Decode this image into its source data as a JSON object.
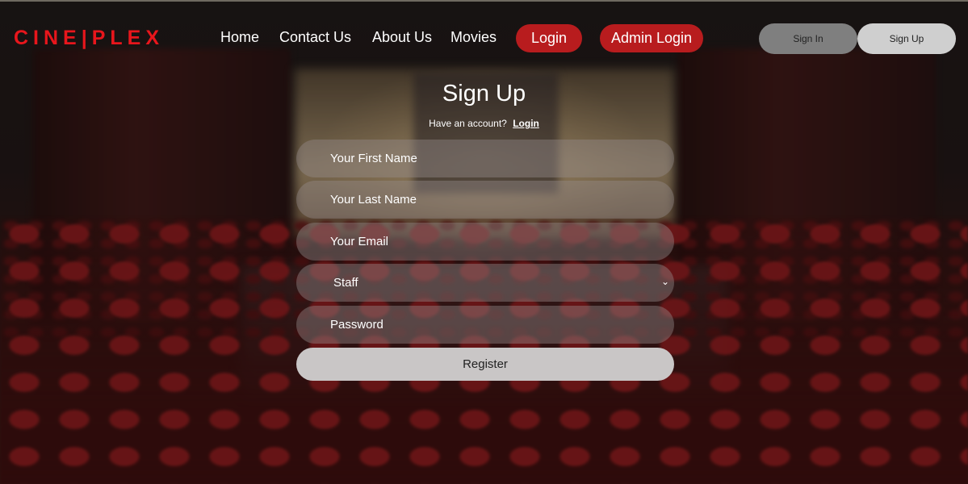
{
  "brand": {
    "logo_text": "CINE|PLEX",
    "color": "#e8161c"
  },
  "nav": {
    "home": "Home",
    "contact": "Contact Us",
    "about": "About Us",
    "movies": "Movies",
    "login": "Login",
    "admin_login": "Admin Login",
    "accent": "#b81c1e"
  },
  "auth_buttons": {
    "sign_in": "Sign In",
    "sign_up": "Sign Up"
  },
  "form": {
    "title": "Sign Up",
    "have_account": "Have an account?",
    "login_link": "Login",
    "first_name_placeholder": "Your First Name",
    "last_name_placeholder": "Your Last Name",
    "email_placeholder": "Your Email",
    "role_selected": "Staff",
    "password_placeholder": "Password",
    "register": "Register"
  }
}
